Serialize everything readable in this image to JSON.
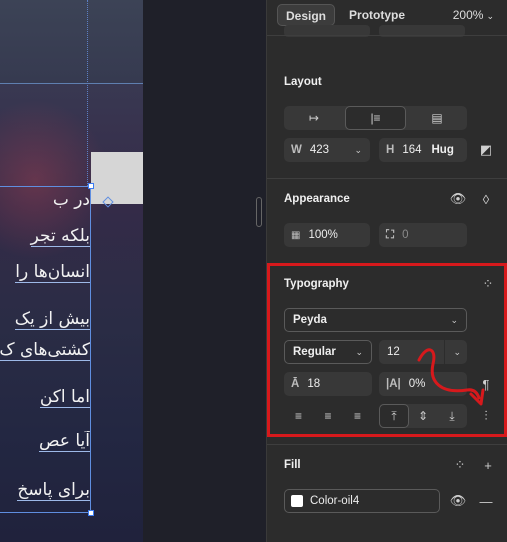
{
  "canvas": {
    "lines": [
      {
        "text": "در ب",
        "underlined": false
      },
      {
        "text": "بلکه تجر",
        "underlined": true
      },
      {
        "text": "انسان‌ها را",
        "underlined": true
      },
      {
        "text": "بیش از یک",
        "underlined": true
      },
      {
        "text": "کشتی‌های ک",
        "underlined": true
      },
      {
        "text": "اما اکن",
        "underlined": true
      },
      {
        "text": "آیا عص",
        "underlined": true
      },
      {
        "text": "برای پاسخ",
        "underlined": true
      }
    ]
  },
  "topbar": {
    "design_tab": "Design",
    "prototype_tab": "Prototype",
    "zoom": "200%"
  },
  "layout": {
    "title": "Layout",
    "width_label": "W",
    "width_value": "423",
    "height_label": "H",
    "height_value": "164",
    "height_mode": "Hug"
  },
  "appearance": {
    "title": "Appearance",
    "opacity": "100%",
    "radius": "0"
  },
  "typography": {
    "title": "Typography",
    "font_family": "Peyda",
    "font_weight": "Regular",
    "font_size": "12",
    "line_height": "18",
    "letter_spacing": "0%"
  },
  "fill": {
    "title": "Fill",
    "color_name": "Color-oil4",
    "color": "#ffffff"
  },
  "colors": {
    "annotation": "#d7191c",
    "selection": "#5f8ee0",
    "panel_bg": "#2c2c2c"
  }
}
